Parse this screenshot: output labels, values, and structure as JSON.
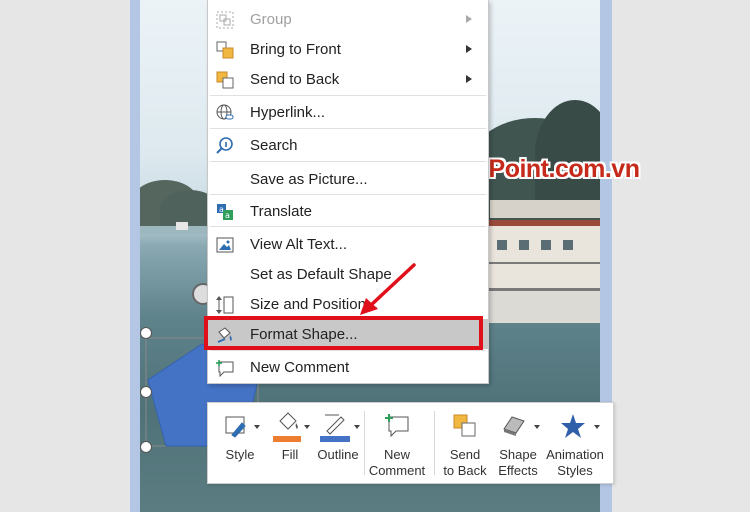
{
  "watermark": {
    "text": "PowerPoint.com.vn",
    "logo_letter": "P"
  },
  "context_menu": {
    "items": [
      {
        "label": "Group",
        "icon": "group-icon",
        "disabled": true,
        "submenu": true
      },
      {
        "label": "Bring to Front",
        "icon": "bring-to-front-icon",
        "submenu": true
      },
      {
        "label": "Send to Back",
        "icon": "send-to-back-icon",
        "submenu": true
      },
      {
        "label": "Hyperlink...",
        "icon": "globe-link-icon"
      },
      {
        "label": "Search",
        "icon": "search-icon"
      },
      {
        "label": "Save as Picture...",
        "icon": ""
      },
      {
        "label": "Translate",
        "icon": "translate-icon"
      },
      {
        "label": "View Alt Text...",
        "icon": "alt-text-icon"
      },
      {
        "label": "Set as Default Shape",
        "icon": ""
      },
      {
        "label": "Size and Position...",
        "icon": "size-position-icon"
      },
      {
        "label": "Format Shape...",
        "icon": "format-shape-icon",
        "highlighted": true
      },
      {
        "label": "New Comment",
        "icon": "new-comment-icon"
      }
    ]
  },
  "mini_toolbar": {
    "style": "Style",
    "fill": "Fill",
    "outline": "Outline",
    "new_comment": [
      "New",
      "Comment"
    ],
    "send_to_back": [
      "Send",
      "to Back"
    ],
    "shape_effects": [
      "Shape",
      "Effects"
    ],
    "animation_styles": [
      "Animation",
      "Styles"
    ]
  },
  "colors": {
    "highlight_border": "#e0101a",
    "shape_fill": "#4472c4",
    "fill_swatch": "#ed7d31",
    "outline_swatch": "#4472c4",
    "watermark_text": "#c62a1a",
    "slide_background": "#b3c6e4"
  }
}
